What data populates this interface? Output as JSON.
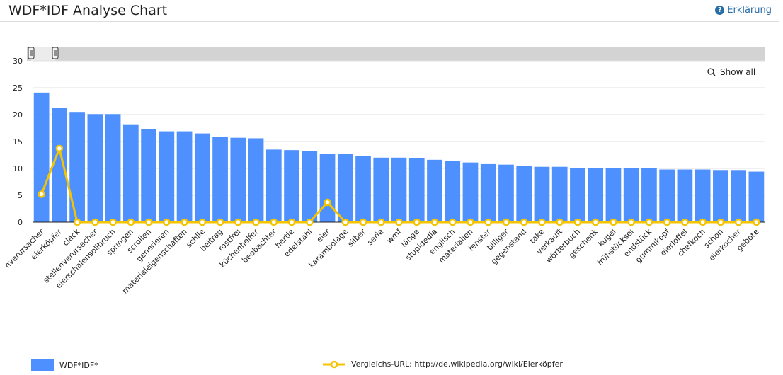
{
  "header": {
    "title": "WDF*IDF Analyse Chart",
    "help_label": "Erklärung",
    "help_icon": "question-circle-icon"
  },
  "zoom": {
    "show_all_label": "Show all",
    "icon": "zoom-out-icon"
  },
  "colors": {
    "bars": "#4d90fe",
    "line": "#f5c400",
    "accent": "#2a6ea8"
  },
  "chart_data": {
    "type": "bar",
    "ylim": [
      0,
      30
    ],
    "yticks": [
      0,
      5,
      10,
      15,
      20,
      25,
      30
    ],
    "grid": true,
    "legend_placement": "bottom",
    "categories": [
      "nverursacher",
      "eierköpfer",
      "clack",
      "stellenverursacher",
      "eierschalensollbruch",
      "springen",
      "scrollen",
      "generieren",
      "materialeigenschaften",
      "schlie",
      "beitrag",
      "rostfrei",
      "küchenhelfer",
      "beobachter",
      "hertie",
      "edelstahl",
      "eier",
      "karambolage",
      "silber",
      "serie",
      "wmf",
      "länge",
      "stupidedia",
      "englisch",
      "materialien",
      "fenster",
      "billiger",
      "gegenstand",
      "take",
      "verkauft",
      "wörterbuch",
      "geschenk",
      "kugel",
      "frühstücksei",
      "endstück",
      "gummikopf",
      "eierlöffel",
      "chefkoch",
      "schon",
      "eierkocher",
      "gebote"
    ],
    "series": [
      {
        "name": "WDF*IDF*",
        "type": "bar",
        "values": [
          24.1,
          21.2,
          20.5,
          20.1,
          20.1,
          18.2,
          17.3,
          16.9,
          16.9,
          16.5,
          15.9,
          15.7,
          15.6,
          13.5,
          13.4,
          13.2,
          12.7,
          12.7,
          12.3,
          12.0,
          12.0,
          11.9,
          11.6,
          11.4,
          11.1,
          10.8,
          10.7,
          10.5,
          10.3,
          10.3,
          10.1,
          10.1,
          10.1,
          10.0,
          10.0,
          9.8,
          9.8,
          9.8,
          9.7,
          9.7,
          9.4
        ]
      },
      {
        "name": "Vergleichs-URL: http://de.wikipedia.org/wiki/Eierköpfer",
        "type": "line",
        "values": [
          5.2,
          13.7,
          0,
          0,
          0,
          0,
          0,
          0,
          0,
          0,
          0,
          0,
          0,
          0,
          0,
          0,
          3.7,
          0,
          0,
          0,
          0,
          0,
          0,
          0,
          0,
          0,
          0,
          0,
          0,
          0,
          0,
          0,
          0,
          0,
          0,
          0,
          0,
          0,
          0,
          0,
          0
        ]
      }
    ]
  }
}
